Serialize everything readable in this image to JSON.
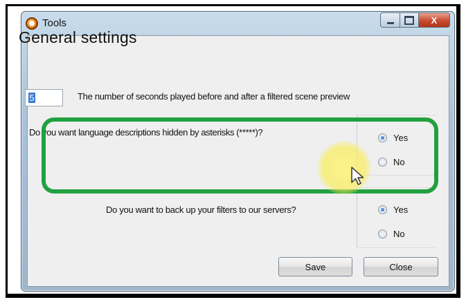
{
  "window": {
    "title": "Tools",
    "controls": {
      "minimize": "minimize",
      "maximize": "maximize",
      "close": "X"
    }
  },
  "main": {
    "heading": "General settings",
    "seconds": {
      "value": "5",
      "label": "The number of seconds played before and after a filtered scene preview"
    },
    "language_question": {
      "text": "Do you want language descriptions hidden by asterisks (*****)?",
      "options": [
        {
          "label": "Yes",
          "checked": true
        },
        {
          "label": "No",
          "checked": false
        }
      ]
    },
    "backup_question": {
      "text": "Do you want to back up your filters to our servers?",
      "options": [
        {
          "label": "Yes",
          "checked": true
        },
        {
          "label": "No",
          "checked": false
        }
      ]
    }
  },
  "buttons": {
    "save": "Save",
    "close": "Close"
  },
  "colors": {
    "highlight": "#21a03f",
    "cursor_halo": "#faec5a",
    "radio_checked": "#1459b8"
  },
  "icons": {
    "app": "app-logo-icon",
    "cursor": "mouse-pointer-icon"
  }
}
